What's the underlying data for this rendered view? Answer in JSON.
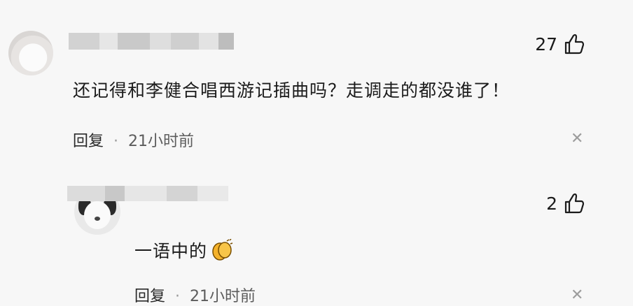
{
  "comments": [
    {
      "text": "还记得和李健合唱西游记插曲吗？走调走的都没谁了！",
      "likes": "27",
      "reply_label": "回复",
      "separator": "·",
      "time": "21小时前"
    },
    {
      "text": "一语中的",
      "emoji_icon": "clapping-hands-icon",
      "likes": "2",
      "reply_label": "回复",
      "separator": "·",
      "time": "21小时前"
    }
  ],
  "icons": {
    "like": "thumbs-up-icon",
    "close": "close-icon"
  },
  "colors": {
    "background": "#f7f7f7",
    "text": "#1b1b1b",
    "meta": "#5c5c5c",
    "icon_muted": "#9d9d9d",
    "emoji": "#f5b22a"
  }
}
